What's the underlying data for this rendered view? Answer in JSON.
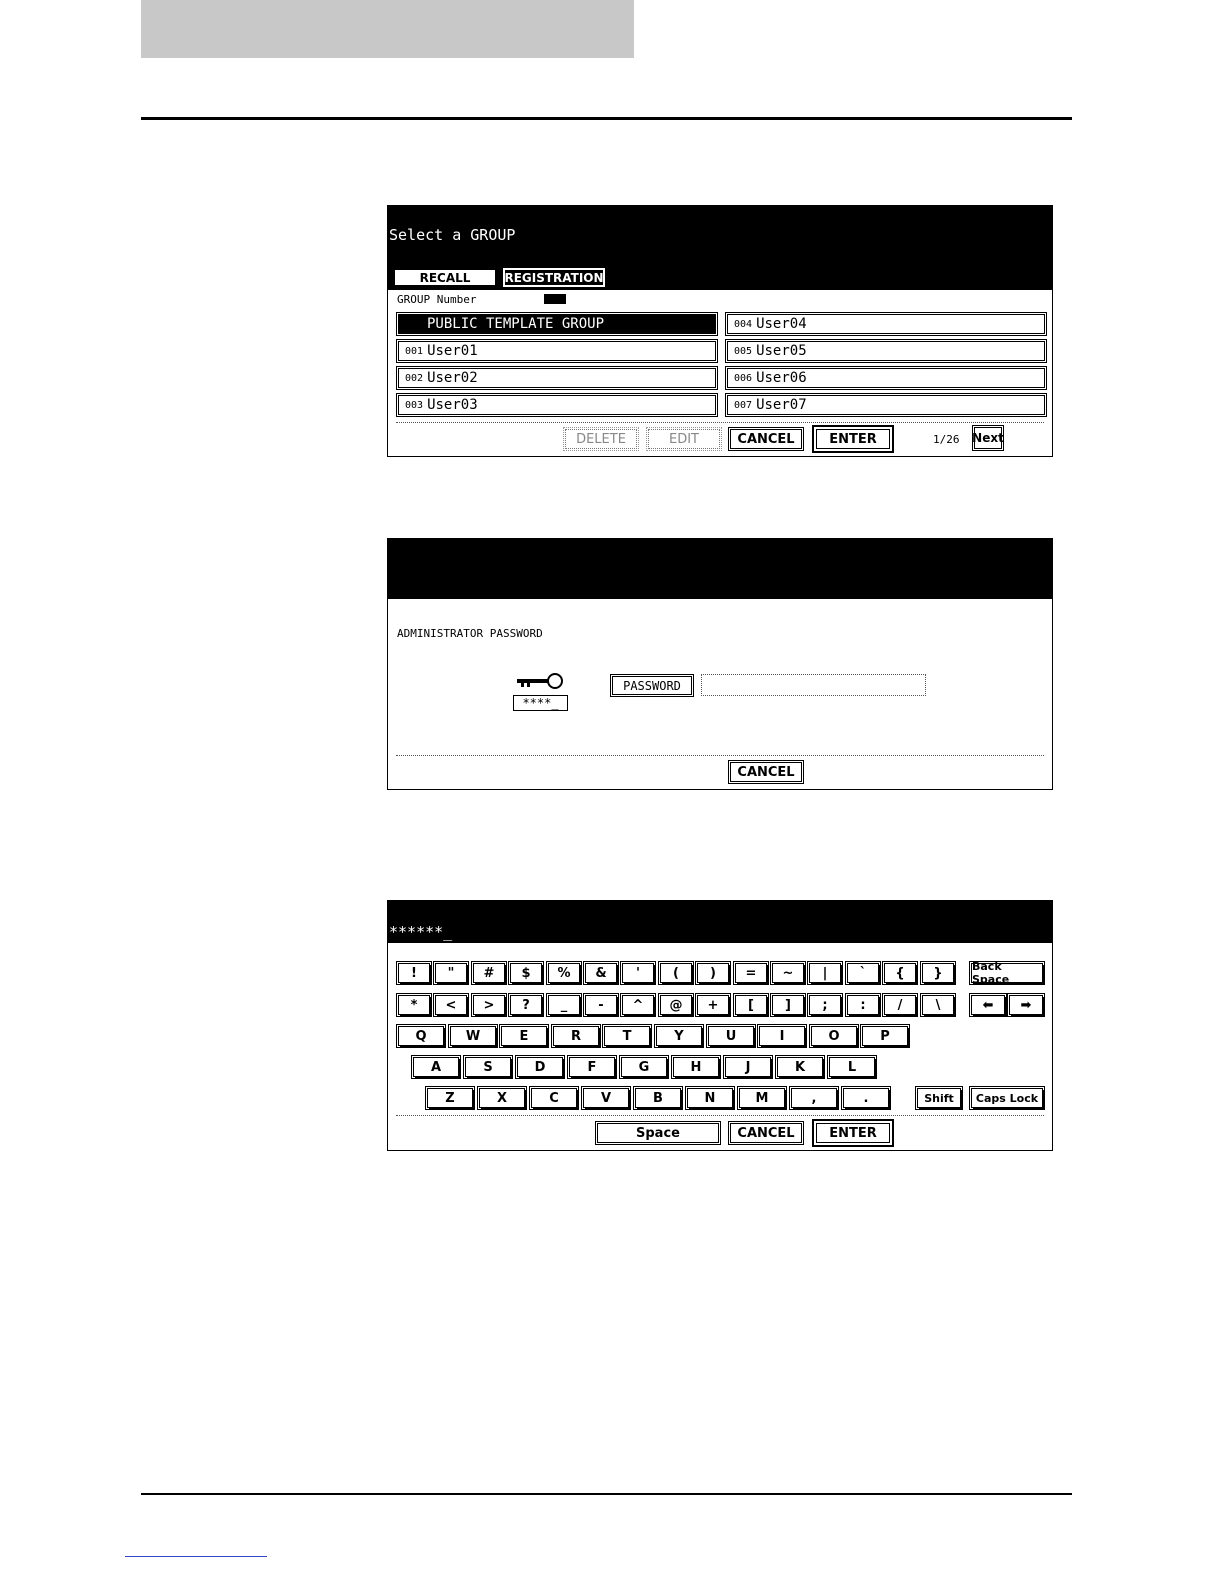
{
  "screen1": {
    "title": "Select a GROUP",
    "tabs": {
      "recall": "RECALL",
      "registration": "REGISTRATION"
    },
    "group_number_label": "GROUP Number",
    "groups": [
      {
        "num": "",
        "name": "PUBLIC TEMPLATE GROUP",
        "selected": true
      },
      {
        "num": "001",
        "name": "User01"
      },
      {
        "num": "002",
        "name": "User02"
      },
      {
        "num": "003",
        "name": "User03"
      },
      {
        "num": "004",
        "name": "User04"
      },
      {
        "num": "005",
        "name": "User05"
      },
      {
        "num": "006",
        "name": "User06"
      },
      {
        "num": "007",
        "name": "User07"
      }
    ],
    "buttons": {
      "delete": "DELETE",
      "edit": "EDIT",
      "cancel": "CANCEL",
      "enter": "ENTER",
      "next": "Next"
    },
    "page": "1/26"
  },
  "screen2": {
    "label": "ADMINISTRATOR PASSWORD",
    "key_icon_text": "****_",
    "password_button": "PASSWORD",
    "password_value": "",
    "cancel": "CANCEL"
  },
  "screen3": {
    "input_value": "******_",
    "row1": [
      "!",
      "\"",
      "#",
      "$",
      "%",
      "&",
      "'",
      "(",
      ")",
      "=",
      "~",
      "|",
      "`",
      "{",
      "}"
    ],
    "row2": [
      "*",
      "<",
      ">",
      "?",
      "_",
      "-",
      "^",
      "@",
      "+",
      "[",
      "]",
      ";",
      ":",
      "/",
      "\\"
    ],
    "row3": [
      "Q",
      "W",
      "E",
      "R",
      "T",
      "Y",
      "U",
      "I",
      "O",
      "P"
    ],
    "row4": [
      "A",
      "S",
      "D",
      "F",
      "G",
      "H",
      "J",
      "K",
      "L"
    ],
    "row5": [
      "Z",
      "X",
      "C",
      "V",
      "B",
      "N",
      "M",
      ",",
      "."
    ],
    "back_space": "Back Space",
    "left_arrow": "⬅",
    "right_arrow": "➡",
    "shift": "Shift",
    "caps_lock": "Caps Lock",
    "space": "Space",
    "cancel": "CANCEL",
    "enter": "ENTER"
  }
}
